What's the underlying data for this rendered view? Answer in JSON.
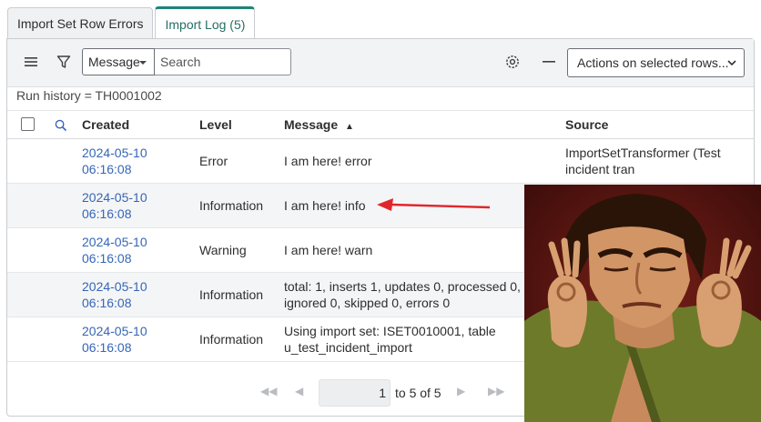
{
  "tabs": [
    {
      "label": "Import Set Row Errors",
      "active": false
    },
    {
      "label": "Import Log (5)",
      "active": true
    }
  ],
  "toolbar": {
    "menu_icon": "hamburger-menu-icon",
    "filter_icon": "funnel-filter-icon",
    "field_select": "Message",
    "search_placeholder": "Search",
    "settings_icon": "gear-icon",
    "collapse_icon": "minus-icon",
    "actions_select": "Actions on selected rows..."
  },
  "breadcrumb": "Run history = TH0001002",
  "columns": {
    "created": "Created",
    "level": "Level",
    "message": "Message",
    "sort_indicator": "▲",
    "source": "Source"
  },
  "rows": [
    {
      "date": "2024-05-10",
      "time": "06:16:08",
      "level": "Error",
      "message1": "I am here! error",
      "message2": "",
      "source1": "ImportSetTransformer (Test",
      "source2": "incident tran"
    },
    {
      "date": "2024-05-10",
      "time": "06:16:08",
      "level": "Information",
      "message1": "I am here! info",
      "message2": "",
      "source1": "",
      "source2": ""
    },
    {
      "date": "2024-05-10",
      "time": "06:16:08",
      "level": "Warning",
      "message1": "I am here! warn",
      "message2": "",
      "source1": "",
      "source2": ""
    },
    {
      "date": "2024-05-10",
      "time": "06:16:08",
      "level": "Information",
      "message1": "total: 1, inserts 1, updates 0, processed 0,",
      "message2": "ignored 0, skipped 0, errors 0",
      "source1": "",
      "source2": ""
    },
    {
      "date": "2024-05-10",
      "time": "06:16:08",
      "level": "Information",
      "message1": "Using import set: ISET0010001, table",
      "message2": "u_test_incident_import",
      "source1": "",
      "source2": ""
    }
  ],
  "pager": {
    "current": "1",
    "range_text": "to 5 of 5"
  },
  "colors": {
    "accent": "#1f8476",
    "link": "#3566b8",
    "annotation_arrow": "#e0262b"
  },
  "overlay": {
    "arrow": "red-annotation-arrow",
    "meme": "cartoon-man-making-ok-hand-gestures-meme"
  }
}
